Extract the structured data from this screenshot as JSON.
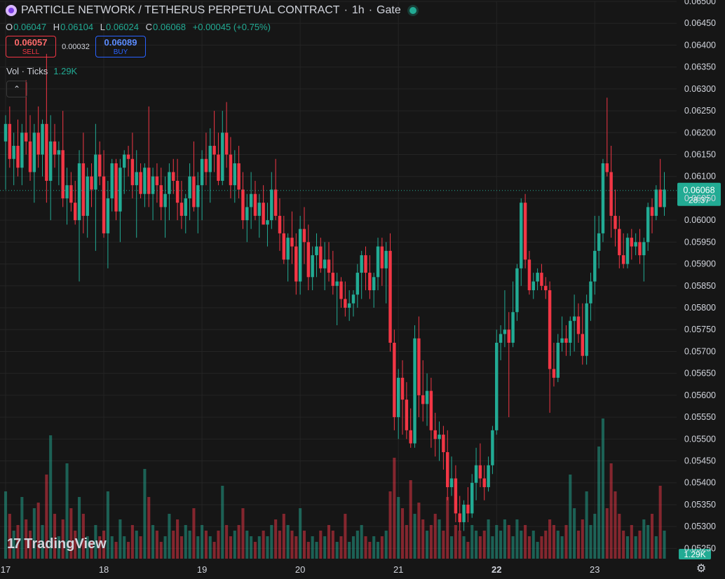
{
  "header": {
    "title": "PARTICLE NETWORK / TETHERUS PERPETUAL CONTRACT",
    "interval": "1h",
    "exchange": "Gate",
    "sep": "·"
  },
  "ohlc": {
    "o_label": "O",
    "o": "0.06047",
    "h_label": "H",
    "h": "0.06104",
    "l_label": "L",
    "l": "0.06024",
    "c_label": "C",
    "c": "0.06068",
    "change": "+0.00045 (+0.75%)"
  },
  "trade": {
    "sell_price": "0.06057",
    "sell_label": "SELL",
    "spread": "0.00032",
    "buy_price": "0.06089",
    "buy_label": "BUY"
  },
  "volume": {
    "label": "Vol · Ticks",
    "value": "1.29K"
  },
  "branding": {
    "name": "TradingView"
  },
  "colors": {
    "up": "#22ab94",
    "down": "#f23645",
    "background": "#161616",
    "grid": "#242424"
  },
  "chart_data": {
    "type": "candlestick",
    "y_ticks": [
      "0.06500",
      "0.06450",
      "0.06400",
      "0.06350",
      "0.06300",
      "0.06250",
      "0.06200",
      "0.06150",
      "0.06100",
      "0.06050",
      "0.06000",
      "0.05950",
      "0.05900",
      "0.05850",
      "0.05800",
      "0.05750",
      "0.05700",
      "0.05650",
      "0.05600",
      "0.05550",
      "0.05500",
      "0.05450",
      "0.05400",
      "0.05350",
      "0.05300",
      "0.05250"
    ],
    "x_ticks": [
      "17",
      "18",
      "19",
      "20",
      "21",
      "22",
      "23"
    ],
    "x_ticks_bold": [
      "22"
    ],
    "last_price": "0.06068",
    "last_price_value": 0.06068,
    "countdown": "28:37",
    "volume_last": "1.29K",
    "ylim": [
      0.05225,
      0.065
    ],
    "candles": [
      [
        0.0618,
        0.0624,
        0.0607,
        0.0622,
        1.2
      ],
      [
        0.0622,
        0.0626,
        0.0612,
        0.0614,
        0.8
      ],
      [
        0.0614,
        0.062,
        0.0608,
        0.0617,
        0.5
      ],
      [
        0.0617,
        0.0623,
        0.061,
        0.0612,
        0.6
      ],
      [
        0.0612,
        0.0622,
        0.0608,
        0.062,
        1.1
      ],
      [
        0.062,
        0.0632,
        0.0615,
        0.0618,
        0.7
      ],
      [
        0.0618,
        0.0624,
        0.0609,
        0.0611,
        0.5
      ],
      [
        0.0611,
        0.0622,
        0.0604,
        0.062,
        0.9
      ],
      [
        0.062,
        0.0626,
        0.0612,
        0.0615,
        1.0
      ],
      [
        0.0615,
        0.0623,
        0.061,
        0.0622,
        0.6
      ],
      [
        0.0622,
        0.0638,
        0.0604,
        0.0609,
        1.5
      ],
      [
        0.0609,
        0.0624,
        0.06,
        0.0618,
        2.2
      ],
      [
        0.0618,
        0.0622,
        0.0612,
        0.0615,
        0.8
      ],
      [
        0.0615,
        0.0618,
        0.0608,
        0.0616,
        0.4
      ],
      [
        0.0616,
        0.0625,
        0.0603,
        0.0605,
        0.7
      ],
      [
        0.0605,
        0.0612,
        0.0599,
        0.0608,
        1.7
      ],
      [
        0.0608,
        0.0611,
        0.0602,
        0.0604,
        0.9
      ],
      [
        0.0604,
        0.0609,
        0.0599,
        0.06,
        0.5
      ],
      [
        0.06,
        0.0616,
        0.0586,
        0.0613,
        1.1
      ],
      [
        0.0613,
        0.062,
        0.0597,
        0.0601,
        0.8
      ],
      [
        0.0601,
        0.0612,
        0.0596,
        0.061,
        0.4
      ],
      [
        0.061,
        0.0613,
        0.0603,
        0.0607,
        0.3
      ],
      [
        0.0607,
        0.0622,
        0.0593,
        0.0615,
        0.6
      ],
      [
        0.0615,
        0.0618,
        0.0608,
        0.061,
        0.4
      ],
      [
        0.061,
        0.0616,
        0.0596,
        0.0597,
        0.5
      ],
      [
        0.0597,
        0.0609,
        0.0589,
        0.0605,
        1.2
      ],
      [
        0.0605,
        0.0614,
        0.0602,
        0.0613,
        0.4
      ],
      [
        0.0613,
        0.0614,
        0.06,
        0.0602,
        0.3
      ],
      [
        0.0602,
        0.0614,
        0.0595,
        0.0612,
        0.7
      ],
      [
        0.0612,
        0.0616,
        0.0606,
        0.0615,
        0.4
      ],
      [
        0.0615,
        0.0617,
        0.061,
        0.0614,
        0.3
      ],
      [
        0.0614,
        0.062,
        0.0605,
        0.0608,
        0.6
      ],
      [
        0.0608,
        0.0616,
        0.0596,
        0.0611,
        0.5
      ],
      [
        0.0611,
        0.0613,
        0.0605,
        0.0606,
        0.4
      ],
      [
        0.0606,
        0.0613,
        0.0603,
        0.0612,
        1.6
      ],
      [
        0.0612,
        0.0626,
        0.0603,
        0.0606,
        1.1
      ],
      [
        0.0606,
        0.0612,
        0.06,
        0.061,
        0.6
      ],
      [
        0.061,
        0.0613,
        0.0604,
        0.0608,
        0.5
      ],
      [
        0.0608,
        0.0612,
        0.06,
        0.0603,
        0.3
      ],
      [
        0.0603,
        0.061,
        0.0596,
        0.0606,
        0.4
      ],
      [
        0.0606,
        0.0613,
        0.06,
        0.0611,
        0.8
      ],
      [
        0.0611,
        0.0614,
        0.0606,
        0.0609,
        0.5
      ],
      [
        0.0609,
        0.0614,
        0.06,
        0.0604,
        0.7
      ],
      [
        0.0604,
        0.0609,
        0.0598,
        0.0601,
        0.4
      ],
      [
        0.0601,
        0.0606,
        0.0597,
        0.0605,
        0.6
      ],
      [
        0.0605,
        0.0613,
        0.06,
        0.061,
        0.5
      ],
      [
        0.061,
        0.0618,
        0.0602,
        0.0603,
        0.9
      ],
      [
        0.0603,
        0.0611,
        0.0597,
        0.0608,
        0.4
      ],
      [
        0.0608,
        0.0616,
        0.06,
        0.0614,
        0.6
      ],
      [
        0.0614,
        0.062,
        0.0608,
        0.0611,
        0.5
      ],
      [
        0.0611,
        0.0621,
        0.0604,
        0.0617,
        0.4
      ],
      [
        0.0617,
        0.0625,
        0.0611,
        0.0615,
        0.3
      ],
      [
        0.0615,
        0.062,
        0.0608,
        0.0609,
        0.5
      ],
      [
        0.0609,
        0.0625,
        0.0608,
        0.062,
        1.3
      ],
      [
        0.062,
        0.0627,
        0.0612,
        0.0615,
        0.6
      ],
      [
        0.0615,
        0.0619,
        0.0605,
        0.0608,
        0.4
      ],
      [
        0.0608,
        0.0616,
        0.0604,
        0.0613,
        0.5
      ],
      [
        0.0613,
        0.0617,
        0.0605,
        0.0607,
        0.6
      ],
      [
        0.0607,
        0.0611,
        0.0598,
        0.06,
        0.9
      ],
      [
        0.06,
        0.0606,
        0.0595,
        0.0603,
        0.5
      ],
      [
        0.0603,
        0.0611,
        0.0598,
        0.0606,
        0.4
      ],
      [
        0.0606,
        0.0609,
        0.06,
        0.0601,
        0.3
      ],
      [
        0.0601,
        0.0606,
        0.0596,
        0.0604,
        0.4
      ],
      [
        0.0604,
        0.0608,
        0.0599,
        0.0599,
        0.5
      ],
      [
        0.0599,
        0.0604,
        0.0594,
        0.06,
        0.4
      ],
      [
        0.06,
        0.0611,
        0.0598,
        0.0607,
        0.6
      ],
      [
        0.0607,
        0.0614,
        0.06,
        0.0601,
        0.7
      ],
      [
        0.0601,
        0.0605,
        0.0593,
        0.0597,
        0.5
      ],
      [
        0.0597,
        0.0601,
        0.059,
        0.0591,
        0.8
      ],
      [
        0.0591,
        0.0597,
        0.0586,
        0.0596,
        0.6
      ],
      [
        0.0596,
        0.0602,
        0.059,
        0.0594,
        0.5
      ],
      [
        0.0594,
        0.0597,
        0.0583,
        0.0586,
        0.4
      ],
      [
        0.0586,
        0.0601,
        0.0583,
        0.0598,
        0.9
      ],
      [
        0.0598,
        0.0603,
        0.059,
        0.0595,
        0.5
      ],
      [
        0.0595,
        0.0599,
        0.0584,
        0.0587,
        0.3
      ],
      [
        0.0587,
        0.0594,
        0.0584,
        0.0592,
        0.4
      ],
      [
        0.0592,
        0.0597,
        0.0587,
        0.0594,
        0.3
      ],
      [
        0.0594,
        0.0596,
        0.0588,
        0.0589,
        0.5
      ],
      [
        0.0589,
        0.0595,
        0.0584,
        0.0591,
        0.4
      ],
      [
        0.0591,
        0.0595,
        0.0586,
        0.0588,
        0.6
      ],
      [
        0.0588,
        0.0593,
        0.0583,
        0.0585,
        0.5
      ],
      [
        0.0585,
        0.0588,
        0.0576,
        0.0586,
        0.3
      ],
      [
        0.0586,
        0.0587,
        0.058,
        0.0582,
        0.4
      ],
      [
        0.0582,
        0.0586,
        0.0578,
        0.058,
        0.8
      ],
      [
        0.058,
        0.0584,
        0.0577,
        0.0581,
        0.3
      ],
      [
        0.0581,
        0.0584,
        0.0578,
        0.0583,
        0.4
      ],
      [
        0.0583,
        0.059,
        0.058,
        0.0588,
        0.5
      ],
      [
        0.0588,
        0.0593,
        0.0582,
        0.0592,
        0.6
      ],
      [
        0.0592,
        0.0594,
        0.0584,
        0.0588,
        0.4
      ],
      [
        0.0588,
        0.0592,
        0.0582,
        0.0584,
        0.3
      ],
      [
        0.0584,
        0.0588,
        0.058,
        0.0587,
        0.4
      ],
      [
        0.0587,
        0.0596,
        0.0584,
        0.0594,
        0.3
      ],
      [
        0.0594,
        0.0596,
        0.0585,
        0.0589,
        0.4
      ],
      [
        0.0589,
        0.0595,
        0.0581,
        0.0593,
        0.5
      ],
      [
        0.0593,
        0.0597,
        0.057,
        0.0572,
        1.2
      ],
      [
        0.0572,
        0.0575,
        0.0552,
        0.0555,
        1.8
      ],
      [
        0.0555,
        0.0566,
        0.055,
        0.0564,
        1.1
      ],
      [
        0.0564,
        0.0568,
        0.0551,
        0.0559,
        0.9
      ],
      [
        0.0559,
        0.0563,
        0.055,
        0.0552,
        0.6
      ],
      [
        0.0552,
        0.0557,
        0.0548,
        0.0549,
        1.4
      ],
      [
        0.0549,
        0.0576,
        0.0548,
        0.0573,
        0.8
      ],
      [
        0.0573,
        0.0578,
        0.0555,
        0.056,
        1.0
      ],
      [
        0.056,
        0.0568,
        0.0554,
        0.0558,
        0.7
      ],
      [
        0.0558,
        0.0565,
        0.0553,
        0.0561,
        0.5
      ],
      [
        0.0561,
        0.0564,
        0.0548,
        0.0552,
        0.6
      ],
      [
        0.0552,
        0.0556,
        0.0546,
        0.055,
        0.8
      ],
      [
        0.055,
        0.0554,
        0.0545,
        0.0551,
        0.7
      ],
      [
        0.0551,
        0.0553,
        0.0543,
        0.0547,
        0.5
      ],
      [
        0.0547,
        0.0552,
        0.0536,
        0.0539,
        1.1
      ],
      [
        0.0539,
        0.0546,
        0.0537,
        0.0541,
        0.4
      ],
      [
        0.0541,
        0.0544,
        0.0531,
        0.0533,
        0.6
      ],
      [
        0.0533,
        0.0537,
        0.0529,
        0.0531,
        0.5
      ],
      [
        0.0531,
        0.0536,
        0.0529,
        0.0535,
        0.4
      ],
      [
        0.0535,
        0.0539,
        0.0531,
        0.0533,
        0.3
      ],
      [
        0.0533,
        0.0542,
        0.0532,
        0.054,
        0.6
      ],
      [
        0.054,
        0.0548,
        0.0536,
        0.0544,
        0.5
      ],
      [
        0.0544,
        0.0549,
        0.0539,
        0.0541,
        0.4
      ],
      [
        0.0541,
        0.0544,
        0.0536,
        0.0539,
        0.5
      ],
      [
        0.0539,
        0.0546,
        0.0538,
        0.0544,
        0.7
      ],
      [
        0.0544,
        0.0553,
        0.0542,
        0.0552,
        0.4
      ],
      [
        0.0552,
        0.0575,
        0.0551,
        0.0572,
        0.6
      ],
      [
        0.0572,
        0.0576,
        0.0568,
        0.0574,
        0.5
      ],
      [
        0.0574,
        0.0584,
        0.0571,
        0.0575,
        0.7
      ],
      [
        0.0575,
        0.0579,
        0.0555,
        0.0572,
        0.6
      ],
      [
        0.0572,
        0.0586,
        0.0571,
        0.0579,
        0.4
      ],
      [
        0.0579,
        0.059,
        0.0577,
        0.0589,
        0.7
      ],
      [
        0.0589,
        0.0605,
        0.0585,
        0.0604,
        0.5
      ],
      [
        0.0604,
        0.0606,
        0.0589,
        0.0591,
        0.6
      ],
      [
        0.0591,
        0.0593,
        0.0583,
        0.0584,
        0.4
      ],
      [
        0.0584,
        0.0588,
        0.0582,
        0.0586,
        0.5
      ],
      [
        0.0586,
        0.0589,
        0.0584,
        0.0588,
        0.3
      ],
      [
        0.0588,
        0.059,
        0.0584,
        0.0585,
        0.4
      ],
      [
        0.0585,
        0.0587,
        0.0582,
        0.0584,
        0.5
      ],
      [
        0.0584,
        0.0586,
        0.0556,
        0.0566,
        0.7
      ],
      [
        0.0566,
        0.0572,
        0.0562,
        0.0564,
        0.6
      ],
      [
        0.0564,
        0.0574,
        0.0563,
        0.0572,
        0.5
      ],
      [
        0.0572,
        0.0578,
        0.057,
        0.0573,
        0.4
      ],
      [
        0.0573,
        0.0576,
        0.0569,
        0.0572,
        0.6
      ],
      [
        0.0572,
        0.0578,
        0.0569,
        0.0577,
        1.5
      ],
      [
        0.0577,
        0.0583,
        0.057,
        0.0578,
        0.9
      ],
      [
        0.0578,
        0.0581,
        0.0572,
        0.0574,
        0.5
      ],
      [
        0.0574,
        0.0581,
        0.0567,
        0.0569,
        0.7
      ],
      [
        0.0569,
        0.0583,
        0.0567,
        0.0581,
        1.2
      ],
      [
        0.0581,
        0.0588,
        0.0577,
        0.0586,
        0.6
      ],
      [
        0.0586,
        0.0601,
        0.0583,
        0.0593,
        0.8
      ],
      [
        0.0593,
        0.0601,
        0.0589,
        0.0597,
        2.0
      ],
      [
        0.0597,
        0.0614,
        0.0595,
        0.0613,
        2.5
      ],
      [
        0.0613,
        0.0628,
        0.061,
        0.0611,
        0.9
      ],
      [
        0.0611,
        0.0617,
        0.0596,
        0.0601,
        1.7
      ],
      [
        0.0601,
        0.0607,
        0.0594,
        0.0598,
        1.2
      ],
      [
        0.0598,
        0.0601,
        0.0589,
        0.0592,
        0.8
      ],
      [
        0.0592,
        0.0597,
        0.0589,
        0.059,
        0.5
      ],
      [
        0.059,
        0.0597,
        0.0589,
        0.0596,
        0.4
      ],
      [
        0.0596,
        0.0598,
        0.0591,
        0.0594,
        0.6
      ],
      [
        0.0594,
        0.0597,
        0.0592,
        0.0595,
        0.4
      ],
      [
        0.0595,
        0.0598,
        0.059,
        0.0592,
        0.5
      ],
      [
        0.0592,
        0.0596,
        0.0586,
        0.0595,
        0.7
      ],
      [
        0.0595,
        0.0604,
        0.0593,
        0.0603,
        0.6
      ],
      [
        0.0603,
        0.0605,
        0.0597,
        0.0601,
        0.8
      ],
      [
        0.0601,
        0.0608,
        0.06,
        0.0607,
        0.4
      ],
      [
        0.0607,
        0.0614,
        0.0603,
        0.0603,
        1.3
      ],
      [
        0.0603,
        0.0611,
        0.0601,
        0.0607,
        0.5
      ]
    ]
  }
}
